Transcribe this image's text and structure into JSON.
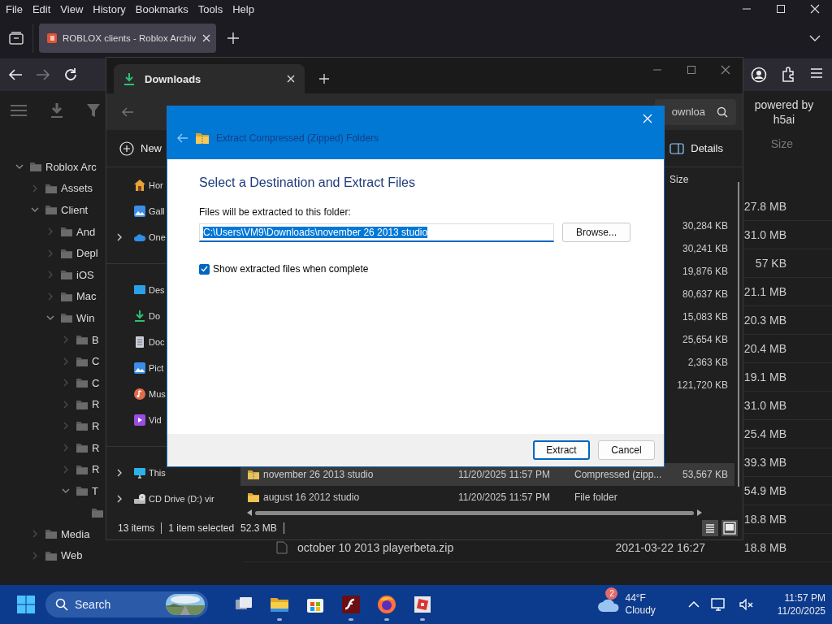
{
  "browser": {
    "menu": [
      "File",
      "Edit",
      "View",
      "History",
      "Bookmarks",
      "Tools",
      "Help"
    ],
    "tab": {
      "title": "ROBLOX clients - Roblox Archiv"
    },
    "sidebar_tree": [
      {
        "label": "Roblox Arc",
        "kind": "folder",
        "expanded": true,
        "children": [
          {
            "label": "Assets",
            "kind": "folder",
            "expanded": false
          },
          {
            "label": "Client",
            "kind": "folder",
            "expanded": true,
            "children": [
              {
                "label": "And",
                "kind": "folder",
                "expanded": false
              },
              {
                "label": "Depl",
                "kind": "folder",
                "expanded": false
              },
              {
                "label": "iOS",
                "kind": "folder",
                "expanded": false
              },
              {
                "label": "Mac",
                "kind": "folder",
                "expanded": false
              },
              {
                "label": "Win",
                "kind": "folder",
                "expanded": true,
                "children": [
                  {
                    "label": "B",
                    "kind": "folder",
                    "expanded": false
                  },
                  {
                    "label": "C",
                    "kind": "folder",
                    "expanded": false
                  },
                  {
                    "label": "C",
                    "kind": "folder",
                    "expanded": false
                  },
                  {
                    "label": "R",
                    "kind": "folder",
                    "expanded": false
                  },
                  {
                    "label": "R",
                    "kind": "folder",
                    "expanded": false
                  },
                  {
                    "label": "R",
                    "kind": "folder",
                    "expanded": false
                  },
                  {
                    "label": "R",
                    "kind": "folder",
                    "expanded": false
                  },
                  {
                    "label": "T",
                    "kind": "folder",
                    "expanded": true,
                    "children": [
                      {
                        "kind": "folder"
                      }
                    ]
                  }
                ]
              }
            ]
          },
          {
            "label": "Media",
            "kind": "folder",
            "expanded": false
          },
          {
            "label": "Web",
            "kind": "folder",
            "expanded": false
          }
        ]
      }
    ],
    "powered_by": "powered by h5ai",
    "listing": {
      "size_header": "Size",
      "rows": [
        {
          "size": "27.8 MB"
        },
        {
          "size": "31.0 MB"
        },
        {
          "size": "57 KB"
        },
        {
          "size": "21.1 MB"
        },
        {
          "size": "20.3 MB"
        },
        {
          "size": "20.4 MB"
        },
        {
          "size": "19.1 MB"
        },
        {
          "size": "31.0 MB"
        },
        {
          "size": "25.4 MB"
        },
        {
          "size": "39.3 MB"
        },
        {
          "size": "54.9 MB"
        },
        {
          "size": "18.8 MB"
        },
        {
          "name": "october 10 2013 playerbeta.zip",
          "date": "2021-03-22 16:27",
          "size": "18.8 MB"
        }
      ]
    }
  },
  "explorer": {
    "tab": {
      "title": "Downloads"
    },
    "search": {
      "placeholder": "ownloa"
    },
    "toolbar": {
      "new": "New",
      "details": "Details"
    },
    "nav_groups": [
      {
        "items": [
          {
            "label": "Hor",
            "kind": "home"
          },
          {
            "label": "Gall",
            "kind": "gallery"
          },
          {
            "label": "One",
            "kind": "cloud",
            "expandable": true
          }
        ]
      },
      {
        "items": [
          {
            "label": "Des",
            "kind": "desktop"
          },
          {
            "label": "Do",
            "kind": "downloads"
          },
          {
            "label": "Doc",
            "kind": "documents"
          },
          {
            "label": "Pict",
            "kind": "pictures"
          },
          {
            "label": "Mus",
            "kind": "music"
          },
          {
            "label": "Vid",
            "kind": "videos"
          }
        ]
      },
      {
        "items": [
          {
            "label": "This",
            "kind": "pc",
            "expandable": true
          },
          {
            "label": "CD Drive (D:) vir",
            "kind": "drive",
            "expandable": true
          }
        ]
      }
    ],
    "size_header": "Size",
    "rows": [
      {
        "size": "30,284 KB"
      },
      {
        "size": "30,241 KB"
      },
      {
        "size": "19,876 KB"
      },
      {
        "size": "80,637 KB"
      },
      {
        "size": "15,083 KB"
      },
      {
        "size": "25,654 KB"
      },
      {
        "size": "2,363 KB"
      },
      {
        "size": "121,720 KB"
      },
      {
        "name": "november 26 2013 studio",
        "kind": "zip",
        "date": "11/20/2025 11:57 PM",
        "type": "Compressed (zipp...",
        "size": "53,567 KB",
        "selected": true
      },
      {
        "name": "august 16 2012 studio",
        "kind": "folder",
        "date": "11/20/2025 11:57 PM",
        "type": "File folder",
        "selected": false
      }
    ],
    "status": {
      "count": "13 items",
      "selection": "1 item selected",
      "size": "52.3 MB"
    }
  },
  "dialog": {
    "title": "Extract Compressed (Zipped) Folders",
    "heading": "Select a Destination and Extract Files",
    "field_label": "Files will be extracted to this folder:",
    "path": {
      "value": "C:\\Users\\VM9\\Downloads\\november 26 2013 studio",
      "highlighted": true
    },
    "browse": "Browse...",
    "show_files": {
      "label": "Show extracted files when complete",
      "checked": true
    },
    "buttons": [
      {
        "label": "Extract",
        "default": true
      },
      {
        "label": "Cancel",
        "default": false
      }
    ]
  },
  "taskbar": {
    "search": {
      "placeholder": "Search"
    },
    "apps": [
      {
        "kind": "task-view",
        "running": false
      },
      {
        "kind": "file-explorer",
        "running": true
      },
      {
        "kind": "store",
        "running": false
      },
      {
        "kind": "flash",
        "running": true
      },
      {
        "kind": "firefox",
        "running": true
      },
      {
        "kind": "roblox",
        "running": true
      }
    ],
    "weather": {
      "badge": "2",
      "temperature": "44°F",
      "condition": "Cloudy"
    },
    "clock": {
      "time": "11:57 PM",
      "date": "11/20/2025"
    }
  }
}
